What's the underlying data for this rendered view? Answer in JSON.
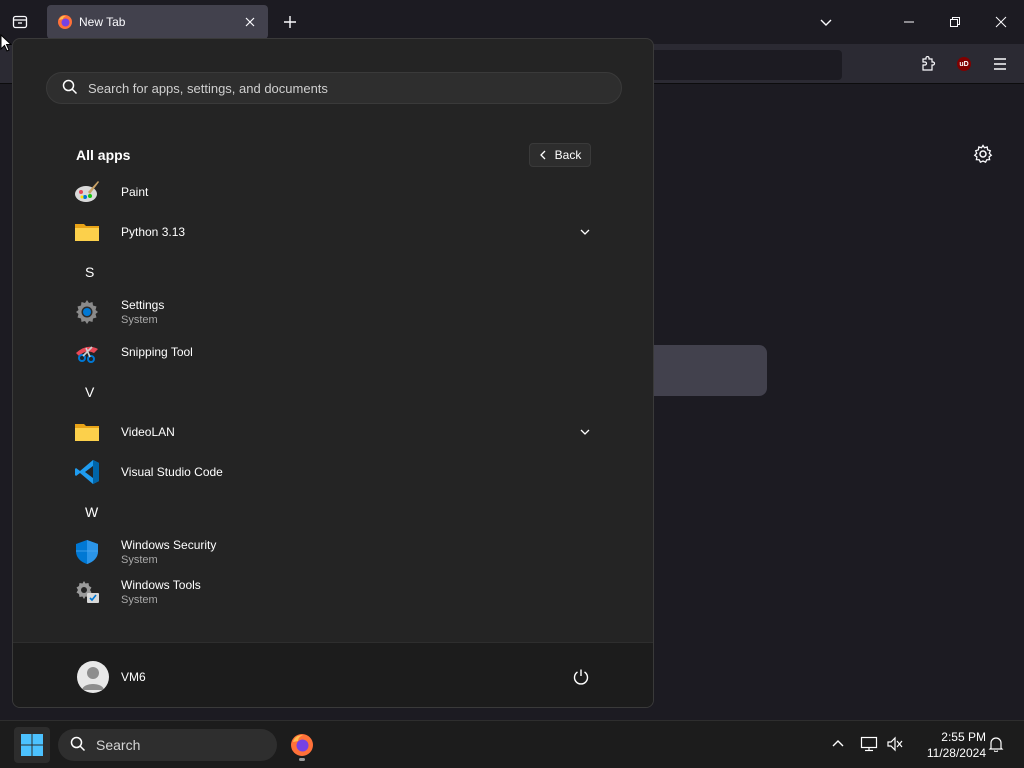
{
  "browser": {
    "tab_title": "New Tab",
    "tab_favicon": "firefox-icon",
    "tab_close_icon": "close-icon",
    "new_tab_icon": "plus-icon",
    "tab_list_icon": "tab-list-icon",
    "window_controls": [
      "minimize-icon",
      "restore-icon",
      "close-icon"
    ],
    "toolbar_icons": [
      "extensions-icon",
      "ublock-icon",
      "menu-icon"
    ],
    "ublock_badge": "uD"
  },
  "start_menu": {
    "search_placeholder": "Search for apps, settings, and documents",
    "section_title": "All apps",
    "back_label": "Back",
    "items": [
      {
        "type": "app",
        "name": "Paint",
        "sub": "",
        "icon": "paint-icon"
      },
      {
        "type": "folder",
        "name": "Python 3.13",
        "sub": "",
        "icon": "folder-icon",
        "expandable": true
      },
      {
        "type": "letter",
        "name": "S"
      },
      {
        "type": "app",
        "name": "Settings",
        "sub": "System",
        "icon": "settings-icon"
      },
      {
        "type": "app",
        "name": "Snipping Tool",
        "sub": "",
        "icon": "snipping-tool-icon"
      },
      {
        "type": "letter",
        "name": "V"
      },
      {
        "type": "folder",
        "name": "VideoLAN",
        "sub": "",
        "icon": "folder-icon",
        "expandable": true
      },
      {
        "type": "app",
        "name": "Visual Studio Code",
        "sub": "",
        "icon": "vscode-icon"
      },
      {
        "type": "letter",
        "name": "W"
      },
      {
        "type": "app",
        "name": "Windows Security",
        "sub": "System",
        "icon": "windows-security-icon"
      },
      {
        "type": "app",
        "name": "Windows Tools",
        "sub": "System",
        "icon": "windows-tools-icon"
      }
    ],
    "user_name": "VM6",
    "power_icon": "power-icon"
  },
  "taskbar": {
    "search_label": "Search",
    "time": "2:55 PM",
    "date": "11/28/2024",
    "tray_icons": [
      "chevron-up-icon",
      "network-icon",
      "sound-muted-icon",
      "notification-bell-icon"
    ]
  },
  "colors": {
    "start_bg": "#242424",
    "browser_bg": "#1c1b22",
    "accent": "#0078d4"
  }
}
